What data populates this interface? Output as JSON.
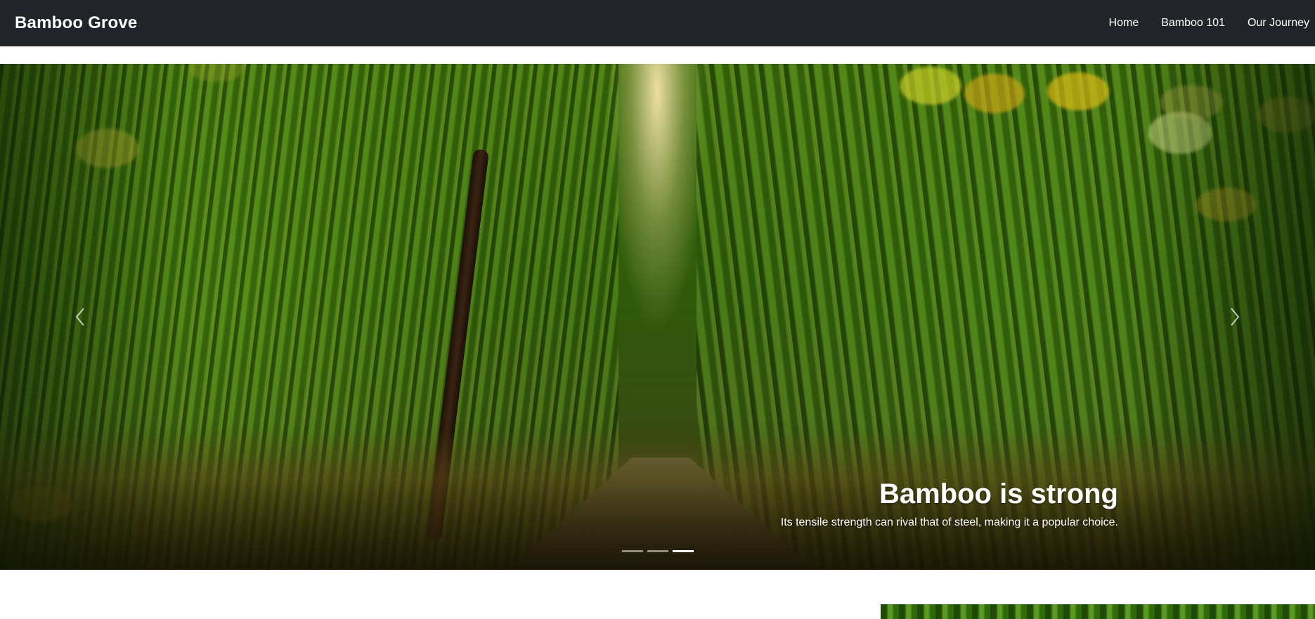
{
  "navbar": {
    "brand": "Bamboo Grove",
    "links": [
      {
        "label": "Home"
      },
      {
        "label": "Bamboo 101"
      },
      {
        "label": "Our Journey"
      }
    ]
  },
  "carousel": {
    "slide_image": "bamboo-forest-path",
    "caption": {
      "title": "Bamboo is strong",
      "text": "Its tensile strength can rival that of steel, making it a popular choice."
    },
    "indicators_count": 3,
    "active_index": 2,
    "prev_icon": "chevron-left-icon",
    "next_icon": "chevron-right-icon"
  },
  "colors": {
    "navbar_bg": "#212529",
    "nav_text": "#ffffff",
    "accent_green": "#3f6d0c"
  }
}
